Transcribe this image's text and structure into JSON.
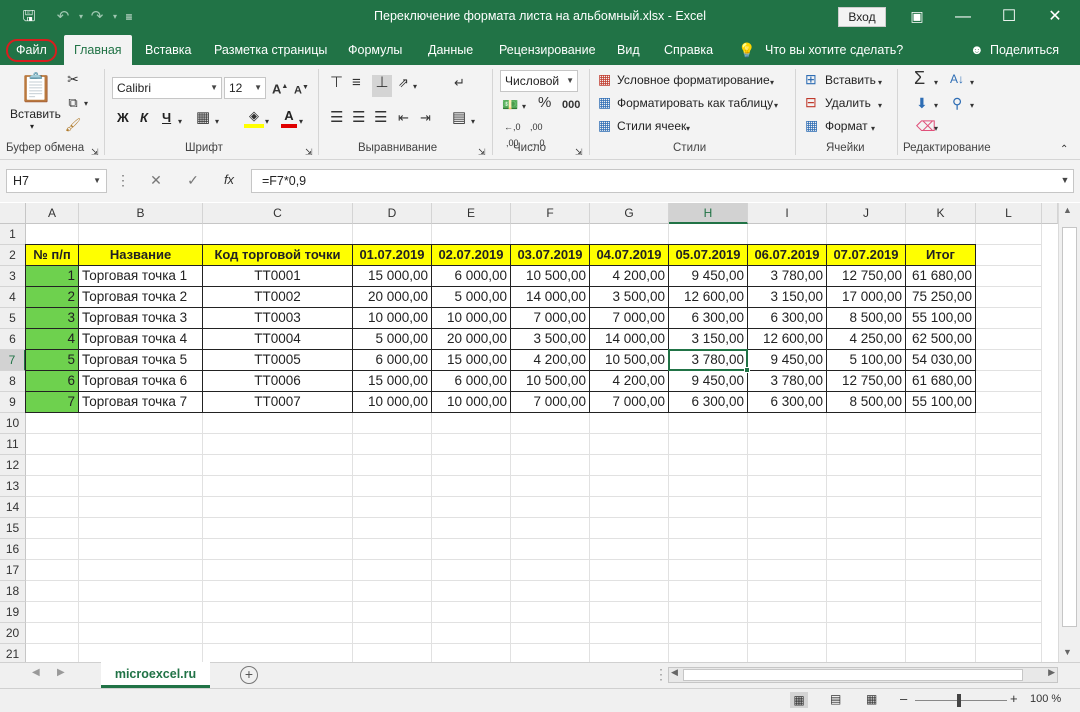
{
  "window": {
    "title": "Переключение формата листа на альбомный.xlsx  -  Excel",
    "login": "Вход"
  },
  "ribbon_tabs": [
    "Файл",
    "Главная",
    "Вставка",
    "Разметка страницы",
    "Формулы",
    "Данные",
    "Рецензирование",
    "Вид",
    "Справка"
  ],
  "tell_me": "Что вы хотите сделать?",
  "share": "Поделиться",
  "clipboard": {
    "paste": "Вставить",
    "label": "Буфер обмена"
  },
  "font": {
    "name": "Calibri",
    "size": "12",
    "bold": "Ж",
    "italic": "К",
    "underline": "Ч",
    "label": "Шрифт"
  },
  "alignment": {
    "label": "Выравнивание"
  },
  "number": {
    "format": "Числовой",
    "label": "Число"
  },
  "styles": {
    "conditional": "Условное форматирование",
    "as_table": "Форматировать как таблицу",
    "cell_styles": "Стили ячеек",
    "label": "Стили"
  },
  "cells_grp": {
    "insert": "Вставить",
    "delete": "Удалить",
    "format": "Формат",
    "label": "Ячейки"
  },
  "editing": {
    "label": "Редактирование"
  },
  "formula_bar": {
    "name_box": "H7",
    "fx": "fx",
    "formula": "=F7*0,9"
  },
  "columns": [
    "A",
    "B",
    "C",
    "D",
    "E",
    "F",
    "G",
    "H",
    "I",
    "J",
    "K",
    "L"
  ],
  "rows": [
    "1",
    "2",
    "3",
    "4",
    "5",
    "6",
    "7",
    "8",
    "9",
    "10",
    "11",
    "12",
    "13",
    "14",
    "15",
    "16",
    "17",
    "18",
    "19",
    "20",
    "21"
  ],
  "table": {
    "headers": [
      "№ п/п",
      "Название",
      "Код торговой точки",
      "01.07.2019",
      "02.07.2019",
      "03.07.2019",
      "04.07.2019",
      "05.07.2019",
      "06.07.2019",
      "07.07.2019",
      "Итог"
    ],
    "rows": [
      [
        "1",
        "Торговая точка 1",
        "ТТ0001",
        "15 000,00",
        "6 000,00",
        "10 500,00",
        "4 200,00",
        "9 450,00",
        "3 780,00",
        "12 750,00",
        "61 680,00"
      ],
      [
        "2",
        "Торговая точка 2",
        "ТТ0002",
        "20 000,00",
        "5 000,00",
        "14 000,00",
        "3 500,00",
        "12 600,00",
        "3 150,00",
        "17 000,00",
        "75 250,00"
      ],
      [
        "3",
        "Торговая точка 3",
        "ТТ0003",
        "10 000,00",
        "10 000,00",
        "7 000,00",
        "7 000,00",
        "6 300,00",
        "6 300,00",
        "8 500,00",
        "55 100,00"
      ],
      [
        "4",
        "Торговая точка 4",
        "ТТ0004",
        "5 000,00",
        "20 000,00",
        "3 500,00",
        "14 000,00",
        "3 150,00",
        "12 600,00",
        "4 250,00",
        "62 500,00"
      ],
      [
        "5",
        "Торговая точка 5",
        "ТТ0005",
        "6 000,00",
        "15 000,00",
        "4 200,00",
        "10 500,00",
        "3 780,00",
        "9 450,00",
        "5 100,00",
        "54 030,00"
      ],
      [
        "6",
        "Торговая точка 6",
        "ТТ0006",
        "15 000,00",
        "6 000,00",
        "10 500,00",
        "4 200,00",
        "9 450,00",
        "3 780,00",
        "12 750,00",
        "61 680,00"
      ],
      [
        "7",
        "Торговая точка 7",
        "ТТ0007",
        "10 000,00",
        "10 000,00",
        "7 000,00",
        "7 000,00",
        "6 300,00",
        "6 300,00",
        "8 500,00",
        "55 100,00"
      ]
    ]
  },
  "sheet_tab": "microexcel.ru",
  "zoom": "100 %",
  "colors": {
    "brand": "#217346",
    "header_fill": "#ffff00",
    "index_fill": "#6ed14e",
    "file_outline": "#d81e1e"
  }
}
